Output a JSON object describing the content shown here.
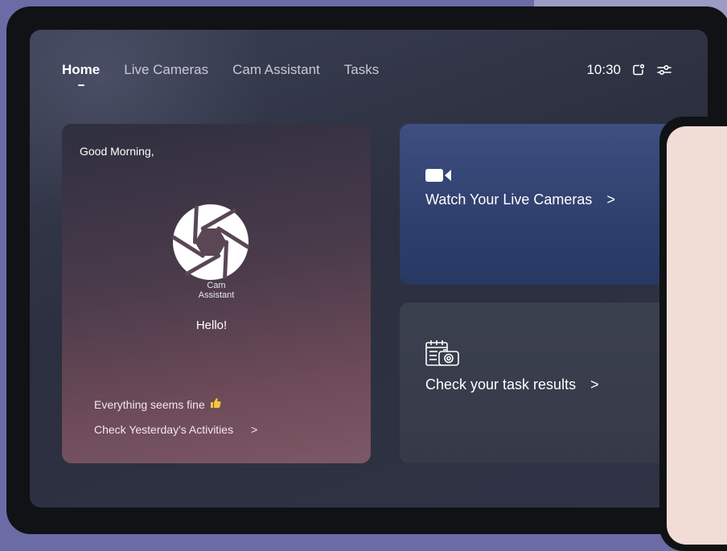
{
  "nav": {
    "items": [
      {
        "label": "Home",
        "active": true
      },
      {
        "label": "Live Cameras",
        "active": false
      },
      {
        "label": "Cam Assistant",
        "active": false
      },
      {
        "label": "Tasks",
        "active": false
      }
    ]
  },
  "status": {
    "time": "10:30",
    "icons": [
      "notification-icon",
      "settings-sliders-icon"
    ]
  },
  "welcome": {
    "greeting": "Good Morning,",
    "logo_line1": "Cam",
    "logo_line2": "Assistant",
    "hello": "Hello!",
    "status_message": "Everything seems fine",
    "status_icon": "thumbs-up-icon",
    "activities_link": "Check Yesterday's Activities",
    "activities_arrow": ">"
  },
  "cards": {
    "cameras": {
      "label": "Watch Your Live Cameras",
      "arrow": ">",
      "icon": "video-camera-icon"
    },
    "tasks": {
      "label": "Check your task results",
      "arrow": ">",
      "icon": "calendar-camera-icon"
    }
  },
  "colors": {
    "background": "#6b6ca6",
    "camera_card": "#33446f",
    "task_card": "#393d4b",
    "welcome_card_bottom": "#7d5866"
  }
}
